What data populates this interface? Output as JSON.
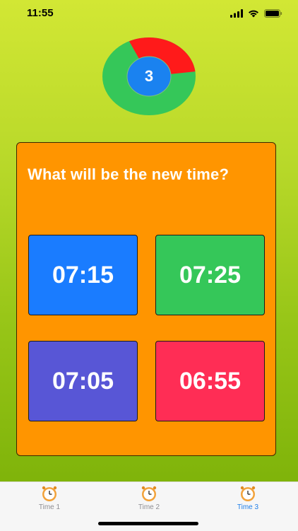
{
  "status": {
    "time": "11:55"
  },
  "timer": {
    "remaining": "3",
    "elapsed_fraction": 0.3,
    "colors": {
      "elapsed": "#ff1a1a",
      "remaining": "#35c759",
      "center": "#1a82f0"
    }
  },
  "question": "What will be the new time?",
  "answers": [
    {
      "label": "07:15",
      "color": "#1a7cff"
    },
    {
      "label": "07:25",
      "color": "#35c759"
    },
    {
      "label": "07:05",
      "color": "#5856d6"
    },
    {
      "label": "06:55",
      "color": "#ff2d55"
    }
  ],
  "tabs": [
    {
      "label": "Time 1",
      "active": false
    },
    {
      "label": "Time 2",
      "active": false
    },
    {
      "label": "Time 3",
      "active": true
    }
  ],
  "icons": {
    "tab": "alarm-clock-icon"
  }
}
